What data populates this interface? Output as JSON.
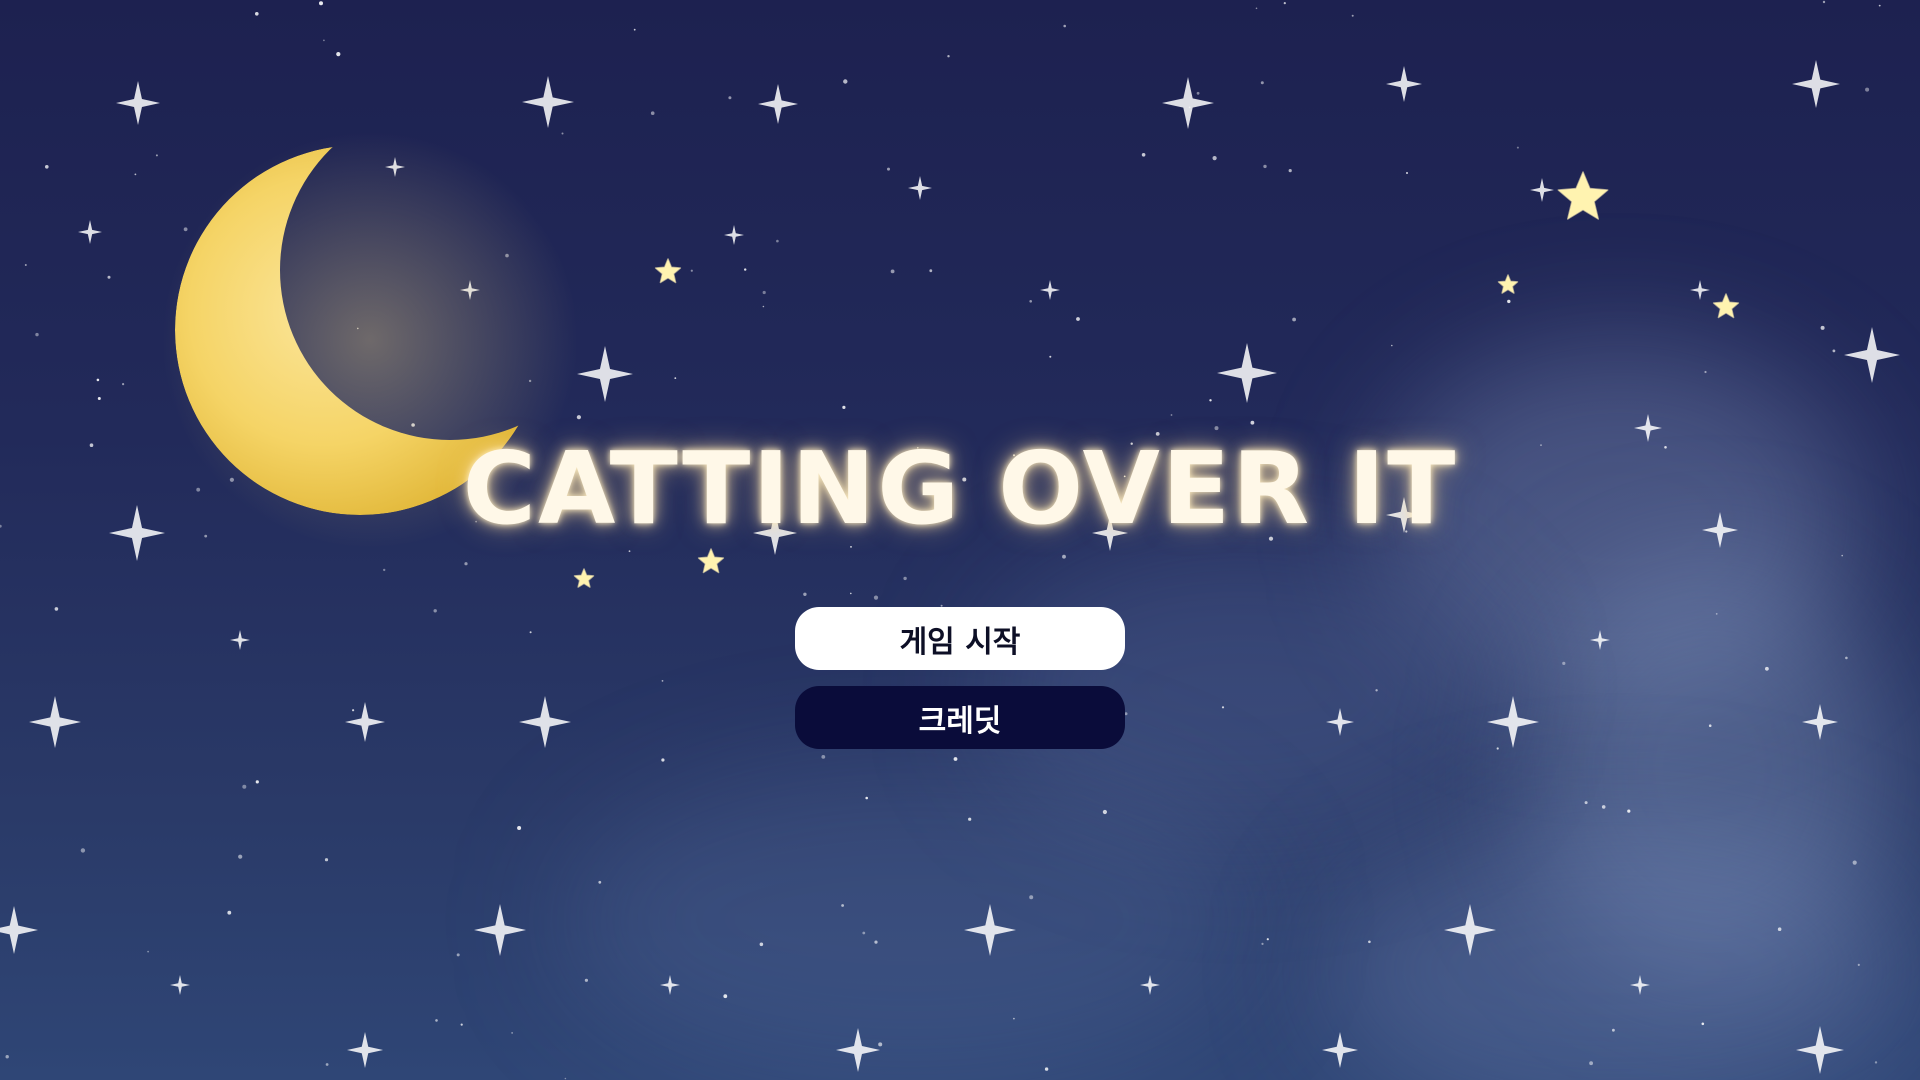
{
  "game": {
    "title": "CATTING OVER IT",
    "menu": {
      "start_label": "게임 시작",
      "credits_label": "크레딧"
    },
    "colors": {
      "sky_top": "#1d2150",
      "sky_bottom": "#2f4676",
      "moon": "#f5d466",
      "title_text": "#fff8e8",
      "start_button_bg": "#ffffff",
      "start_button_text": "#0d0f26",
      "credits_button_bg": "#0a0c3a",
      "credits_button_text": "#ffffff",
      "star": "#fff3b0"
    },
    "decorations": {
      "background": "night-sky-with-clouds",
      "icons": [
        "crescent-moon-icon",
        "star-icon",
        "sparkle-icon"
      ]
    }
  }
}
